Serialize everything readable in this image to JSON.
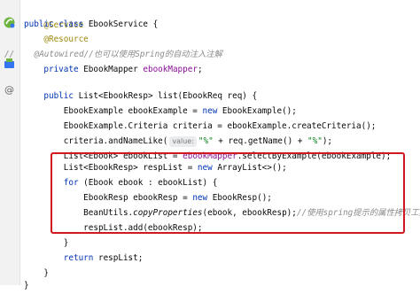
{
  "code": {
    "service_annotation": "@Service",
    "kw_public": "public",
    "kw_class": "class",
    "kw_private": "private",
    "kw_new": "new",
    "kw_for": "for",
    "kw_return": "return",
    "class_name": "EbookService",
    "open_brace": " {",
    "close_brace": "}",
    "resource_annotation": "@Resource",
    "comment_slashes": "//",
    "autowired_comment": "    @Autowired//也可以使用Spring的自动注入注解",
    "mapper_type": "EbookMapper",
    "mapper_field": "ebookMapper",
    "semicolon": ";",
    "list_signature": "List<EbookResp> list(EbookReq req) {",
    "line_example_lhs": "EbookExample ebookExample = ",
    "line_example_rhs": "EbookExample();",
    "line_criteria": "EbookExample.Criteria criteria = ebookExample.createCriteria();",
    "line_namelike_start": "criteria.andNameLike(",
    "hint_value": "value:",
    "string_percent": "\"%\"",
    "line_namelike_mid": " + req.getName() + ",
    "line_namelike_end": ");",
    "line_ebooklist_lhs": "List<Ebook> ebookList = ",
    "line_ebooklist_rhs": ".selectByExample(ebookExample);",
    "line_resplist_lhs": "List<EbookResp> respList = ",
    "line_resplist_rhs": "ArrayList<>();",
    "line_for_rest": " (Ebook ebook : ebookList) {",
    "line_ebookresp_lhs": "EbookResp ebookResp = ",
    "line_ebookresp_rhs": "EbookResp();",
    "beanutils_prefix": "BeanUtils.",
    "copy_properties": "copyProperties",
    "beanutils_args": "(ebook, ebookResp);",
    "beanutils_comment": "//使用spring提示的属性拷贝工具",
    "line_add": "respList.add(ebookResp);",
    "return_rest": " respList;"
  },
  "gutter_icons": [
    "spring-bean-icon",
    "injection-point-icon",
    "method-annotation-icon"
  ]
}
